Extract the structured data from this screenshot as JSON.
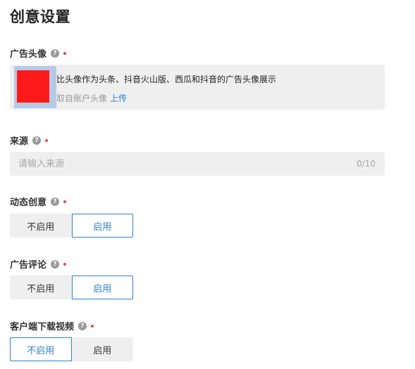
{
  "page_title": "创意设置",
  "help_glyph": "?",
  "avatar_field": {
    "label": "广告头像",
    "description": "比头像作为头条、抖音火山版、西瓜和抖音的广告头像展示",
    "source_text": "取自账户头像",
    "upload_label": "上传"
  },
  "source_field": {
    "label": "来源",
    "placeholder": "请输入来源",
    "value": "",
    "char_count": "0/10"
  },
  "dynamic_creative": {
    "label": "动态创意",
    "options": [
      "不启用",
      "启用"
    ],
    "selected": "启用"
  },
  "ad_comment": {
    "label": "广告评论",
    "options": [
      "不启用",
      "启用"
    ],
    "selected": "启用"
  },
  "client_download_video": {
    "label": "客户端下载视频",
    "options": [
      "不启用",
      "启用"
    ],
    "selected": "不启用"
  },
  "colors": {
    "accent": "#2f7fd8",
    "required": "#e8484b",
    "avatar_red": "#ff1a1a",
    "field_bg": "#efefef"
  }
}
